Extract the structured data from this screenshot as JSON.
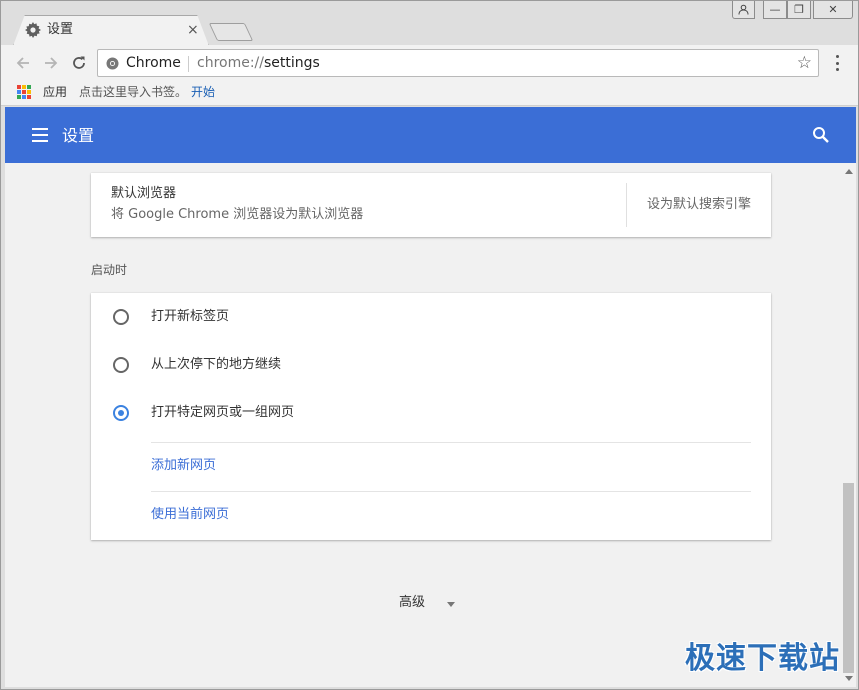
{
  "tab": {
    "title": "设置",
    "close": "×"
  },
  "window_controls": {
    "min": "—",
    "max": "❐",
    "close": "✕"
  },
  "toolbar": {
    "site_name": "Chrome",
    "url_scheme": "chrome://",
    "url_host": "settings",
    "star": "☆"
  },
  "bookmarks": {
    "apps_label": "应用",
    "hint": "点击这里导入书签。",
    "start_link": "开始",
    "apps_colors": [
      "#e94235",
      "#fbbc04",
      "#34a853",
      "#4285f4",
      "#e94235",
      "#fbbc04",
      "#34a853",
      "#4285f4",
      "#e94235"
    ]
  },
  "appbar": {
    "title": "设置",
    "color": "#3b6ed6"
  },
  "default_browser": {
    "title": "默认浏览器",
    "subtitle": "将 Google Chrome 浏览器设为默认浏览器",
    "button": "设为默认搜索引擎"
  },
  "startup": {
    "section_title": "启动时",
    "options": [
      {
        "label": "打开新标签页",
        "checked": false
      },
      {
        "label": "从上次停下的地方继续",
        "checked": false
      },
      {
        "label": "打开特定网页或一组网页",
        "checked": true
      }
    ],
    "add_page": "添加新网页",
    "use_current": "使用当前网页"
  },
  "advanced": {
    "label": "高级"
  },
  "watermark": "极速下载站"
}
